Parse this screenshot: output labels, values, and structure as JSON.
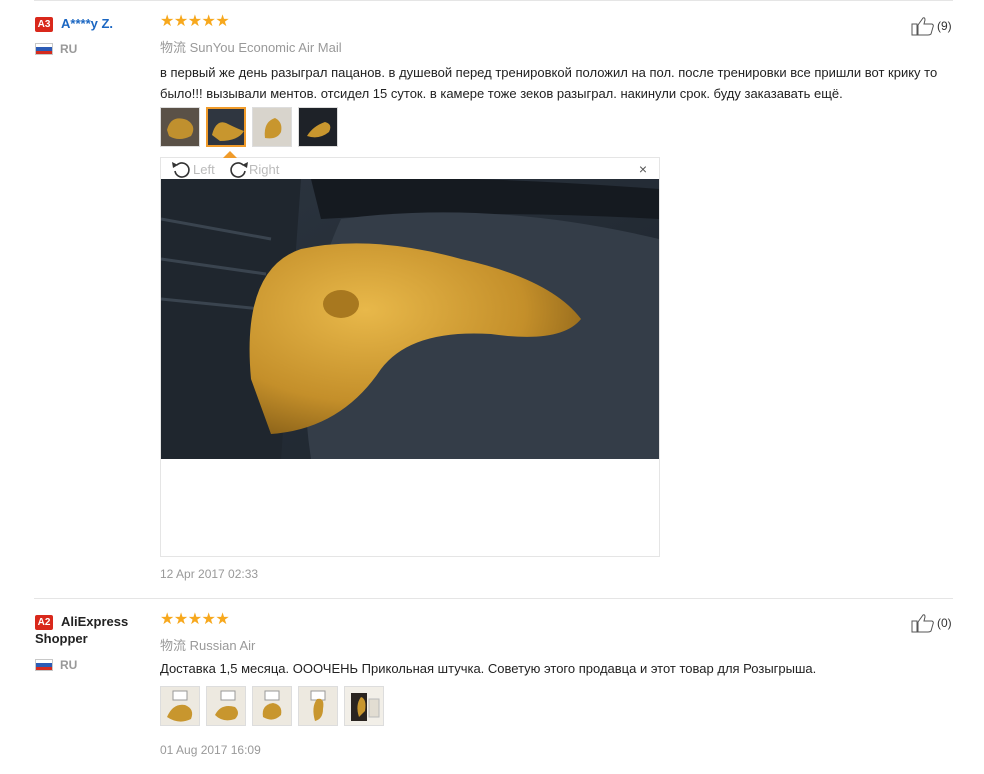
{
  "reviews": [
    {
      "level": "A3",
      "name": "A****y Z.",
      "country": "RU",
      "stars": "★★★★★",
      "logistics_label": "物流",
      "logistics": "SunYou Economic Air Mail",
      "text": "в первый же день разыграл пацанов. в душевой перед тренировкой положил на пол. после тренировки все пришли вот крику то было!!! вызывали ментов. отсидел 15 суток. в камере тоже зеков разыграл. накинули срок. буду заказавать ещё.",
      "likes": "(9)",
      "date": "12 Apr 2017 02:33",
      "viewer": {
        "rotate_left": "Left",
        "rotate_right": "Right",
        "close": "×"
      }
    },
    {
      "level": "A2",
      "name": "AliExpress Shopper",
      "country": "RU",
      "stars": "★★★★★",
      "logistics_label": "物流",
      "logistics": "Russian Air",
      "text": "Доставка 1,5 месяца. ОООЧЕНЬ Прикольная штучка. Советую этого продавца и этот товар для Розыгрыша.",
      "likes": "(0)",
      "date": "01 Aug 2017 16:09"
    }
  ],
  "colors": {
    "star": "#f7a81d",
    "badge": "#d9281b",
    "name_blue": "#1a66c2",
    "active_thumb": "#f09b2a"
  }
}
